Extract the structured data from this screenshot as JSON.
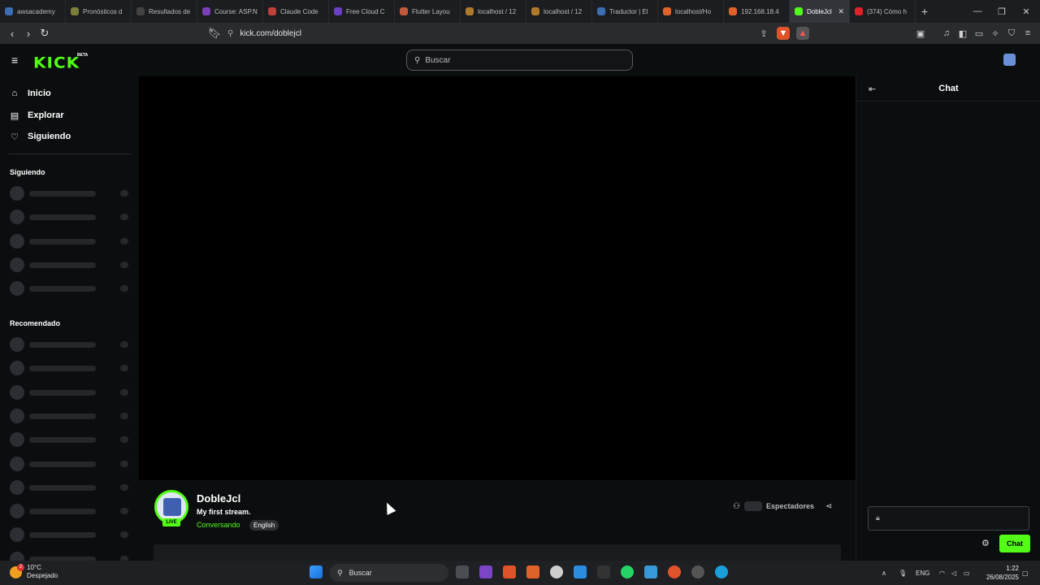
{
  "browser": {
    "tabs": [
      {
        "title": "awsacademy",
        "color": "#3a6fb5"
      },
      {
        "title": "Pronósticos d",
        "color": "#7b7f3a"
      },
      {
        "title": "Resultados de",
        "color": "#444"
      },
      {
        "title": "Course: ASP.N",
        "color": "#7b3fb5"
      },
      {
        "title": "Claude Code",
        "color": "#c0403a"
      },
      {
        "title": "Free Cloud C",
        "color": "#6a3fc5"
      },
      {
        "title": "Flutter Layou",
        "color": "#c05a3a"
      },
      {
        "title": "localhost / 12",
        "color": "#b07a2a"
      },
      {
        "title": "localhost / 12",
        "color": "#b07a2a"
      },
      {
        "title": "Traductor | El",
        "color": "#3a6fb5"
      },
      {
        "title": "localhost/Ho",
        "color": "#e0642a"
      },
      {
        "title": "192.168.18.4",
        "color": "#e0642a"
      }
    ],
    "active_tab": {
      "title": "DobleJcl",
      "color": "#53fc18"
    },
    "last_tab": {
      "title": "(374) Cómo h",
      "color": "#e0202a"
    },
    "url": "kick.com/doblejcl"
  },
  "header": {
    "logo": "KICK",
    "beta": "BETA",
    "search_placeholder": "Buscar"
  },
  "sidebar": {
    "nav": [
      {
        "label": "Inicio",
        "icon": "home-icon",
        "glyph": "⌂"
      },
      {
        "label": "Explorar",
        "icon": "browse-icon",
        "glyph": "▤"
      },
      {
        "label": "Siguiendo",
        "icon": "heart-icon",
        "glyph": "♡"
      }
    ],
    "following_title": "Siguiendo",
    "recommended_title": "Recomendado"
  },
  "stream": {
    "channel": "DobleJcl",
    "title": "My first stream.",
    "category": "Conversando",
    "language": "English",
    "live": "LIVE",
    "viewers_label": "Espectadores"
  },
  "chat": {
    "title": "Chat",
    "send_label": "Chat"
  },
  "taskbar": {
    "temp": "10°C",
    "weather": "Despejado",
    "weather_badge": "2",
    "search": "Buscar",
    "lang": "ENG",
    "time": "1:22",
    "date": "26/08/2025"
  },
  "colors": {
    "accent": "#53fc18",
    "bg": "#0b0e0f"
  }
}
